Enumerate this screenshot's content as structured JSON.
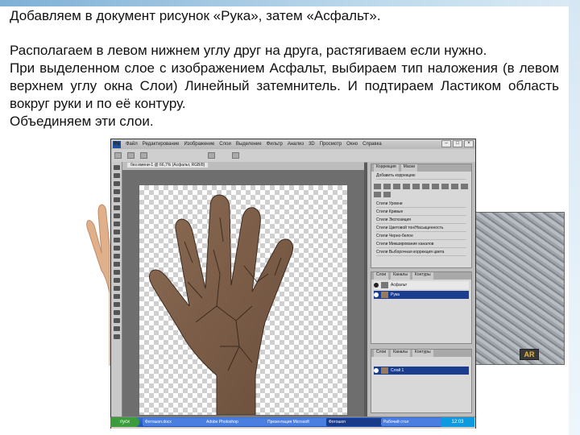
{
  "slide": {
    "title": "Добавляем в документ рисунок «Рука», затем «Асфальт».",
    "paragraphs": [
      "Располагаем в левом нижнем углу друг на друга, растягиваем если нужно.",
      "При выделенном слое с изображением Асфальт, выбираем тип наложения (в левом верхнем углу окна Слои) Линейный затемнитель. И подтираем Ластиком область вокруг руки и по её контуру.",
      "Объединяем эти слои."
    ]
  },
  "photoshop": {
    "logo": "Ps",
    "menu": [
      "Файл",
      "Редактирование",
      "Изображение",
      "Слои",
      "Выделение",
      "Фильтр",
      "Анализ",
      "3D",
      "Просмотр",
      "Окно",
      "Справка"
    ],
    "window_controls": [
      "–",
      "□",
      "×"
    ],
    "document_tab": "без имени-1 @ 66,7% (Асфальт, RGB/8)",
    "adjustments_tabs": [
      "Коррекция",
      "Маски"
    ],
    "adjustments_heading": "Добавить коррекцию",
    "presets": [
      "Стили Уровни",
      "Стили Кривые",
      "Стили Экспозиция",
      "Стили Цветовой тон/Насыщенность",
      "Стили Черно-белое",
      "Стили Микширование каналов",
      "Стили Выборочная коррекция цвета"
    ],
    "layers_tabs": [
      "Слои",
      "Каналы",
      "Контуры"
    ],
    "layers_group_1": [
      {
        "name": "Асфальт",
        "selected": false
      },
      {
        "name": "Рука",
        "selected": true
      }
    ],
    "layers_group_2": [
      {
        "name": "Слой 1",
        "selected": true
      }
    ]
  },
  "taskbar": {
    "start": "пуск",
    "tasks": [
      "Фотошоп.docx",
      "Adobe Photoshop",
      "Презентация Microsoft",
      "Фотошоп",
      "Рабочий стол"
    ],
    "clock": "12:03"
  },
  "badge": "AR"
}
